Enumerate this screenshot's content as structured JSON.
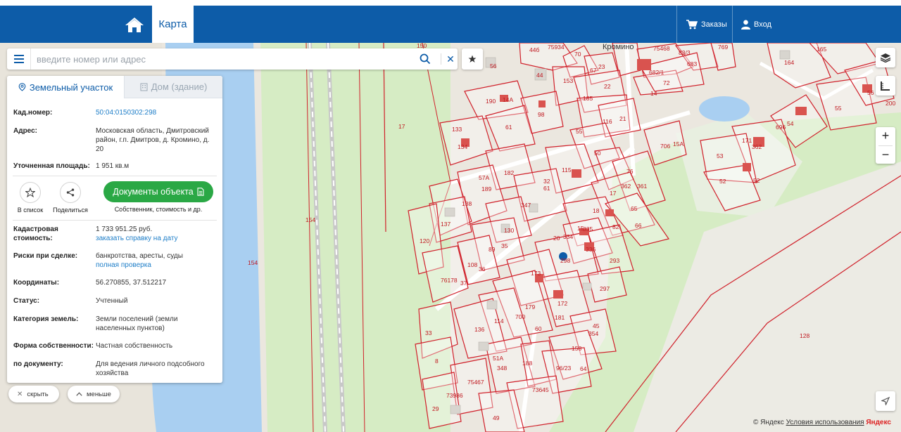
{
  "nav": {
    "map_tab": "Карта",
    "orders": "Заказы",
    "login": "Вход"
  },
  "search": {
    "placeholder": "введите номер или адрес"
  },
  "panel": {
    "tab_land": "Земельный участок",
    "tab_house": "Дом (здание)",
    "cad_label": "Кад.номер:",
    "cad_value": "50:04:0150302:298",
    "address_label": "Адрес:",
    "address_value": "Московская область, Дмитровский район, г.п. Дмитров, д. Кромино, д. 20",
    "area_label": "Уточненная площадь:",
    "area_value": "1 951 кв.м",
    "to_list": "В список",
    "share": "Поделиться",
    "docs_button": "Документы объекта",
    "docs_sub": "Собственник, стоимость и др.",
    "cost_label": "Кадастровая стоимость:",
    "cost_value": "1 733 951.25 руб.",
    "cost_link": "заказать справку на дату",
    "risks_label": "Риски при сделке:",
    "risks_value": "банкротства, аресты, суды",
    "risks_link": "полная проверка",
    "coords_label": "Координаты:",
    "coords_value": "56.270855, 37.512217",
    "status_label": "Статус:",
    "status_value": "Учтенный",
    "category_label": "Категория земель:",
    "category_value": "Земли поселений (земли населенных пунктов)",
    "ownership_label": "Форма собственности:",
    "ownership_value": "Частная собственность",
    "doc_label": "по документу:",
    "doc_value": "Для ведения личного подсобного хозяйства"
  },
  "bottom": {
    "hide": "скрыть",
    "less": "меньше"
  },
  "map": {
    "village": "Кромино",
    "copyright_prefix": "© Яндекс",
    "terms": "Условия использования",
    "brand": "Яндекс",
    "parcels": [
      "150",
      "75934",
      "44б",
      "70",
      "67",
      "23",
      "75468",
      "83/3",
      "769",
      "165",
      "56",
      "44",
      "153",
      "22",
      "682/1",
      "683",
      "164",
      "72",
      "14",
      "190",
      "14А",
      "98",
      "185",
      "116",
      "21",
      "56",
      "200",
      "55",
      "17",
      "133",
      "134",
      "61",
      "55",
      "50",
      "706",
      "15А",
      "696",
      "54",
      "171",
      "362",
      "53",
      "52",
      "52",
      "182",
      "115",
      "76",
      "361",
      "57А",
      "189",
      "61",
      "32",
      "362",
      "138",
      "347",
      "17",
      "65",
      "137",
      "130",
      "18",
      "82",
      "66",
      "120",
      "89",
      "35",
      "335",
      "15",
      "334",
      "336",
      "20",
      "298",
      "293",
      "76178",
      "108",
      "36",
      "37",
      "173",
      "297",
      "172",
      "179",
      "181",
      "700",
      "114",
      "136",
      "33",
      "45",
      "354",
      "60",
      "8",
      "51А",
      "348",
      "188",
      "158",
      "96/23",
      "64",
      "29",
      "73986",
      "75467",
      "73645",
      "49",
      "128",
      "154",
      "154"
    ]
  },
  "colors": {
    "brand_blue": "#0d5ca8",
    "parcel_red": "#d0202a",
    "green_button": "#2aa845",
    "link_blue": "#1e7ec8"
  }
}
